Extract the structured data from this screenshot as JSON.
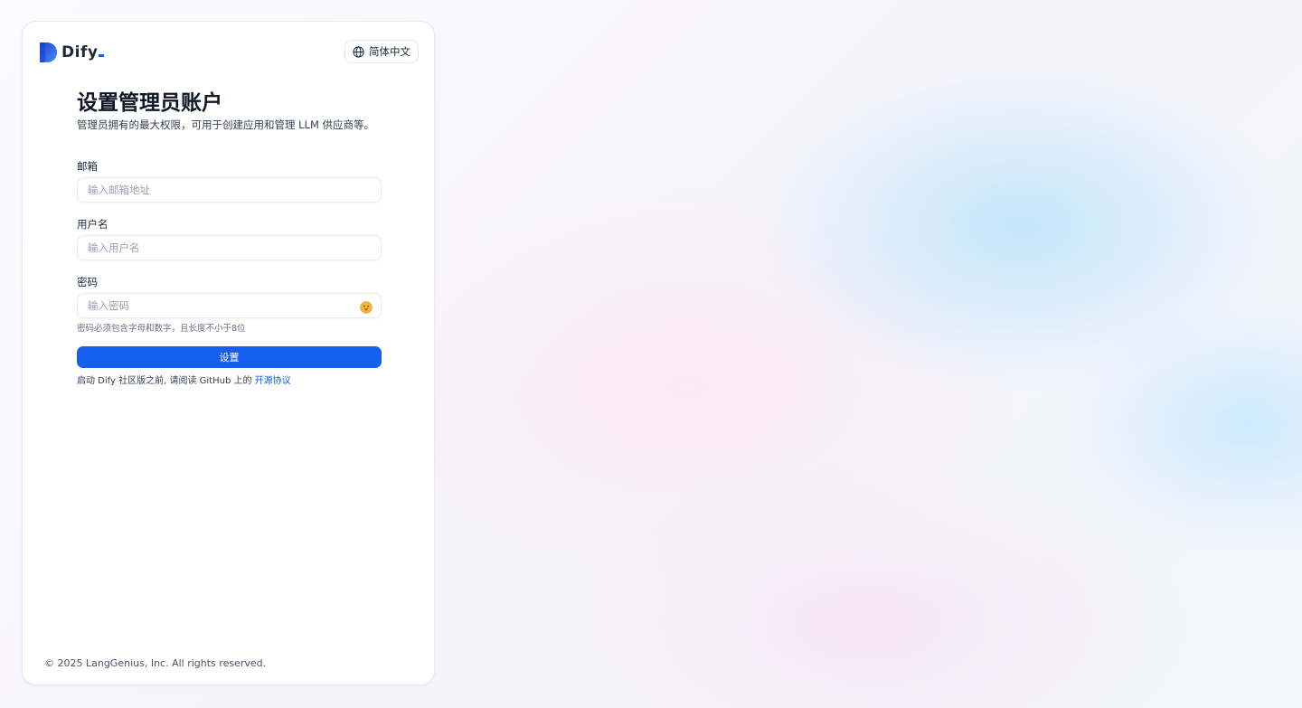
{
  "brand": {
    "name": "Dify"
  },
  "language_switcher": {
    "label": "简体中文",
    "icon": "globe-icon"
  },
  "form": {
    "title": "设置管理员账户",
    "subtitle": "管理员拥有的最大权限，可用于创建应用和管理 LLM 供应商等。",
    "email": {
      "label": "邮箱",
      "placeholder": "输入邮箱地址",
      "value": ""
    },
    "username": {
      "label": "用户名",
      "placeholder": "输入用户名",
      "value": ""
    },
    "password": {
      "label": "密码",
      "placeholder": "输入密码",
      "value": "",
      "toggle_icon": "eye-toggle-icon"
    },
    "password_hint": "密码必须包含字母和数字，且长度不小于8位",
    "submit_label": "设置",
    "license_prefix": "启动 Dify 社区版之前, 请阅读 GitHub 上的 ",
    "license_link": "开源协议"
  },
  "footer": {
    "copyright": "© 2025 LangGenius, Inc. All rights reserved."
  },
  "colors": {
    "accent": "#155eef",
    "text": "#101828",
    "muted": "#667085"
  }
}
